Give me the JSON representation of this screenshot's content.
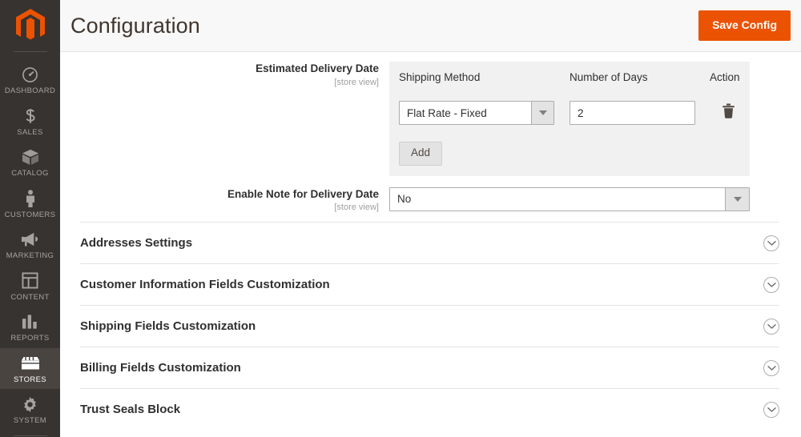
{
  "sidebar": {
    "logo_name": "magento-logo",
    "items": [
      {
        "label": "DASHBOARD",
        "icon": "dashboard-gauge-icon",
        "active": false
      },
      {
        "label": "SALES",
        "icon": "dollar-sign-icon",
        "active": false
      },
      {
        "label": "CATALOG",
        "icon": "box-icon",
        "active": false
      },
      {
        "label": "CUSTOMERS",
        "icon": "person-icon",
        "active": false
      },
      {
        "label": "MARKETING",
        "icon": "megaphone-icon",
        "active": false
      },
      {
        "label": "CONTENT",
        "icon": "layout-page-icon",
        "active": false
      },
      {
        "label": "REPORTS",
        "icon": "bar-chart-icon",
        "active": false
      },
      {
        "label": "STORES",
        "icon": "storefront-icon",
        "active": true
      },
      {
        "label": "SYSTEM",
        "icon": "gear-icon",
        "active": false
      }
    ]
  },
  "header": {
    "title": "Configuration",
    "save_label": "Save Config",
    "accent_color": "#eb5202"
  },
  "fields": {
    "estimated_delivery_date": {
      "label": "Estimated Delivery Date",
      "scope": "[store view]",
      "table": {
        "columns": [
          "Shipping Method",
          "Number of Days",
          "Action"
        ],
        "rows": [
          {
            "shipping_method": "Flat Rate - Fixed",
            "number_of_days": "2",
            "action_icon": "trash-icon"
          }
        ],
        "add_label": "Add"
      }
    },
    "enable_note_for_delivery_date": {
      "label": "Enable Note for Delivery Date",
      "scope": "[store view]",
      "value": "No"
    }
  },
  "sections": [
    {
      "title": "Addresses Settings",
      "icon": "chevron-down-circle-icon"
    },
    {
      "title": "Customer Information Fields Customization",
      "icon": "chevron-down-circle-icon"
    },
    {
      "title": "Shipping Fields Customization",
      "icon": "chevron-down-circle-icon"
    },
    {
      "title": "Billing Fields Customization",
      "icon": "chevron-down-circle-icon"
    },
    {
      "title": "Trust Seals Block",
      "icon": "chevron-down-circle-icon"
    }
  ]
}
